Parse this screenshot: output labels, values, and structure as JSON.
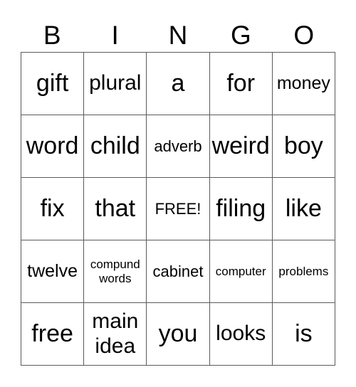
{
  "header": [
    "B",
    "I",
    "N",
    "G",
    "O"
  ],
  "cells": [
    [
      "gift",
      "plural",
      "a",
      "for",
      "money"
    ],
    [
      "word",
      "child",
      "adverb",
      "weird",
      "boy"
    ],
    [
      "fix",
      "that",
      "FREE!",
      "filing",
      "like"
    ],
    [
      "twelve",
      "compund\nwords",
      "cabinet",
      "computer",
      "problems"
    ],
    [
      "free",
      "main\nidea",
      "you",
      "looks",
      "is"
    ]
  ]
}
